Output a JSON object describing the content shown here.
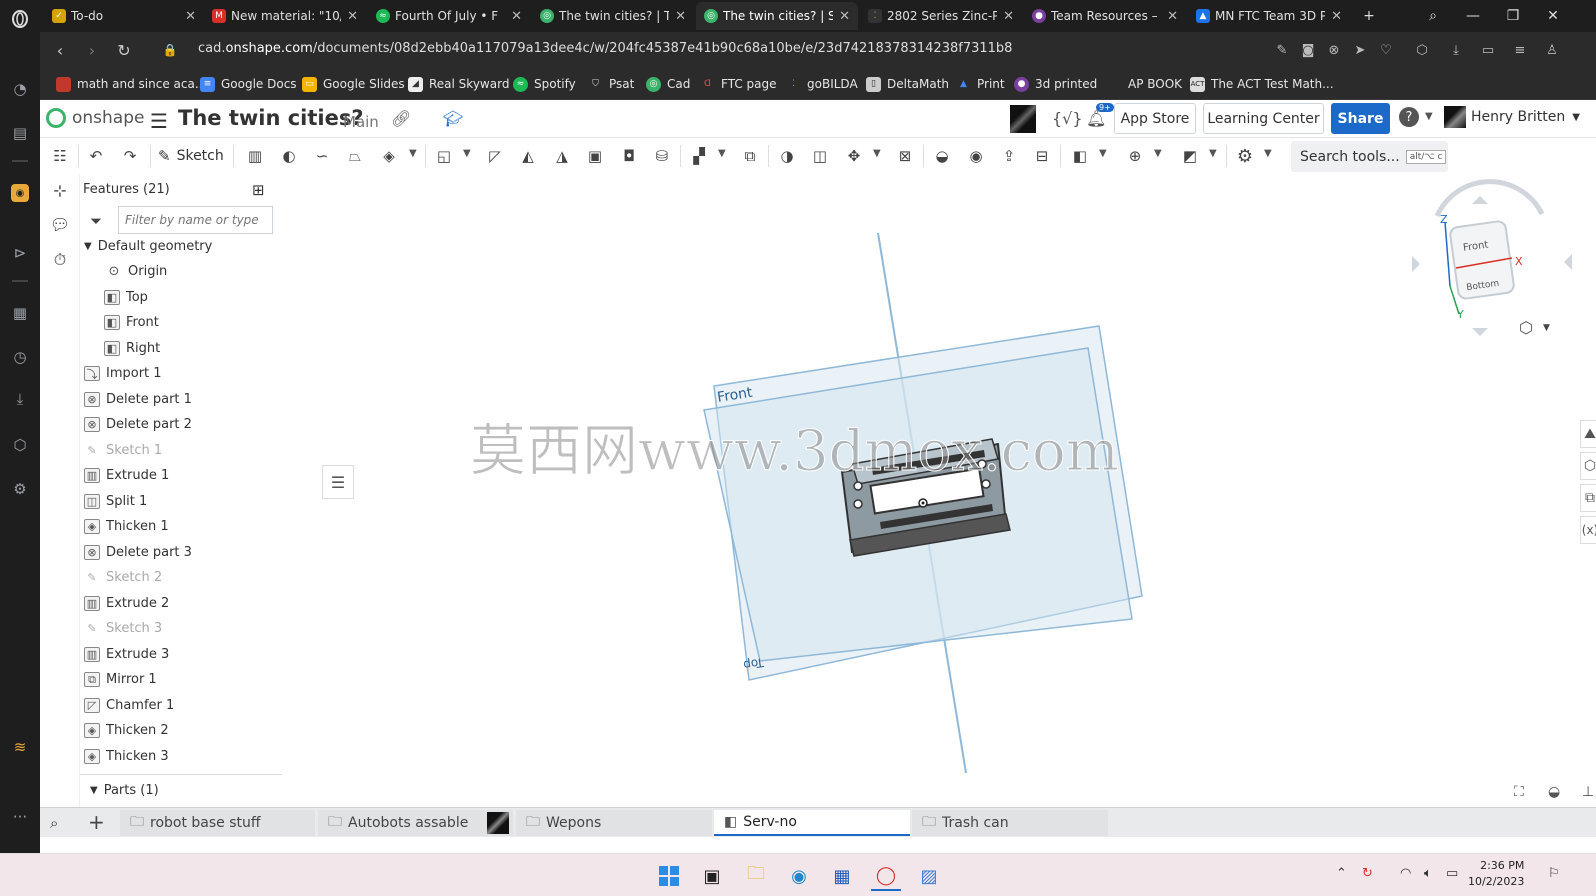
{
  "browser": {
    "tabs": [
      {
        "label": "To-do",
        "color": "#d6a400",
        "icon": "todo-icon"
      },
      {
        "label": "New material: \"10/2",
        "color": "#d93025",
        "icon": "gmail-icon"
      },
      {
        "label": "Fourth Of July • F",
        "color": "#1db954",
        "icon": "spotify-icon"
      },
      {
        "label": "The twin cities? | The",
        "color": "#3bb36b",
        "icon": "onshape-icon"
      },
      {
        "label": "The twin cities? | Serv",
        "color": "#3bb36b",
        "icon": "onshape-icon"
      },
      {
        "label": "2802 Series Zinc-Plat",
        "color": "#c8a600",
        "icon": "gobilda-icon"
      },
      {
        "label": "Team Resources – Hig",
        "color": "#7b3fa0",
        "icon": "first-icon"
      },
      {
        "label": "MN FTC Team 3D Prin",
        "color": "#1a73e8",
        "icon": "drive-icon"
      }
    ],
    "url_prefix": "cad.",
    "url_domain": "onshape.com",
    "url_path": "/documents/08d2ebb40a117079a13dee4c/w/204fc45387e41b90c68a10be/e/23d74218378314238f7311b8",
    "bookmarks": [
      {
        "label": "math and since aca...",
        "color": "#c0392b"
      },
      {
        "label": "Google Docs",
        "color": "#4285f4"
      },
      {
        "label": "Google Slides",
        "color": "#f4b400"
      },
      {
        "label": "Real Skyward",
        "color": "#eeeeee"
      },
      {
        "label": "Spotify",
        "color": "#1db954"
      },
      {
        "label": "Psat",
        "color": "#555555"
      },
      {
        "label": "Cad",
        "color": "#3bb36b"
      },
      {
        "label": "FTC page",
        "color": "#e74c3c"
      },
      {
        "label": "goBILDA",
        "color": "#c8a600"
      },
      {
        "label": "DeltaMath",
        "color": "#cccccc"
      },
      {
        "label": "Print",
        "color": "#4285f4"
      },
      {
        "label": "3d printed",
        "color": "#7b3fa0"
      },
      {
        "label": "AP BOOK",
        "color": ""
      },
      {
        "label": "The ACT Test Math...",
        "color": "#dddddd"
      }
    ]
  },
  "onshape": {
    "logo_text": "onshape",
    "doc_title": "The twin cities?",
    "branch": "Main",
    "notification_count": "9+",
    "app_store": "App Store",
    "learning_center": "Learning Center",
    "share": "Share",
    "user_name": "Henry Britten",
    "sketch_label": "Sketch",
    "search_tools": "Search tools...",
    "search_kbd": "alt/⌥ c",
    "features_header": "Features (21)",
    "filter_placeholder": "Filter by name or type",
    "features": [
      {
        "label": "Default geometry",
        "type": "group"
      },
      {
        "label": "Origin",
        "type": "origin"
      },
      {
        "label": "Top",
        "type": "plane"
      },
      {
        "label": "Front",
        "type": "plane"
      },
      {
        "label": "Right",
        "type": "plane"
      },
      {
        "label": "Import 1",
        "type": "feature"
      },
      {
        "label": "Delete part 1",
        "type": "feature"
      },
      {
        "label": "Delete part 2",
        "type": "feature"
      },
      {
        "label": "Sketch 1",
        "type": "sketch"
      },
      {
        "label": "Extrude 1",
        "type": "feature"
      },
      {
        "label": "Split 1",
        "type": "feature"
      },
      {
        "label": "Thicken 1",
        "type": "feature"
      },
      {
        "label": "Delete part 3",
        "type": "feature"
      },
      {
        "label": "Sketch 2",
        "type": "sketch"
      },
      {
        "label": "Extrude 2",
        "type": "feature"
      },
      {
        "label": "Sketch 3",
        "type": "sketch"
      },
      {
        "label": "Extrude 3",
        "type": "feature"
      },
      {
        "label": "Mirror 1",
        "type": "feature"
      },
      {
        "label": "Chamfer 1",
        "type": "feature"
      },
      {
        "label": "Thicken 2",
        "type": "feature"
      },
      {
        "label": "Thicken 3",
        "type": "feature"
      }
    ],
    "parts_header": "Parts (1)",
    "plane_front": "Front",
    "plane_top": "Top",
    "view_cube": {
      "front": "Front",
      "bottom": "Bottom",
      "x": "X",
      "y": "Y",
      "z": "Z"
    },
    "watermark": "莫西网www.3dmox.com",
    "bottom_tabs": [
      "robot base stuff",
      "Autobots assable",
      "Wepons",
      "Serv-no",
      "Trash can"
    ],
    "active_bottom_tab": "Serv-no"
  },
  "taskbar": {
    "time": "2:36 PM",
    "date": "10/2/2023"
  }
}
